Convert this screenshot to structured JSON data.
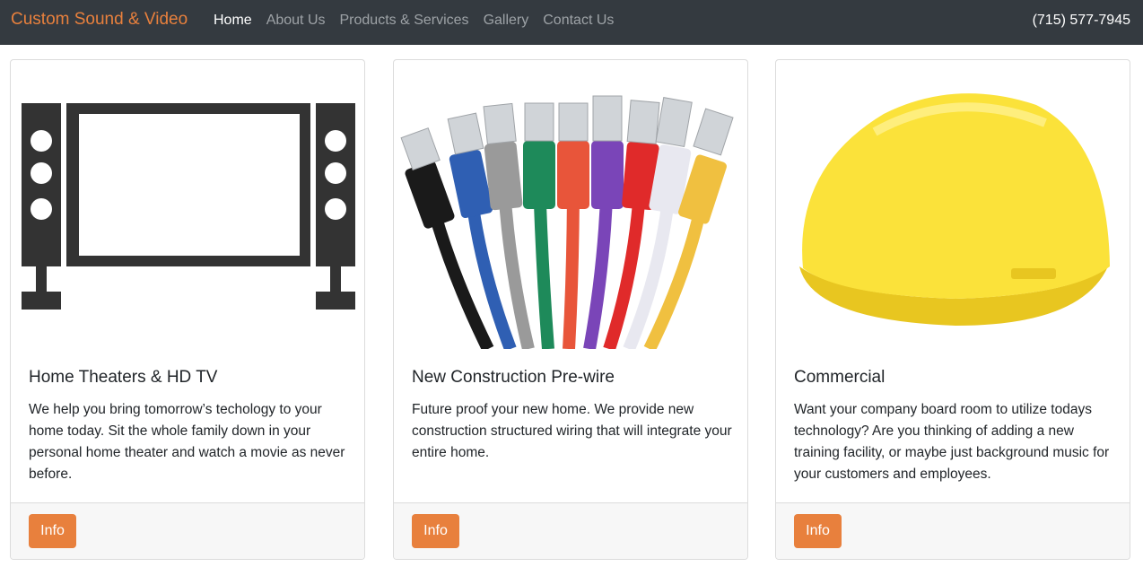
{
  "header": {
    "brand": "Custom Sound & Video",
    "nav": [
      "Home",
      "About Us",
      "Products & Services",
      "Gallery",
      "Contact Us"
    ],
    "active_nav": "Home",
    "phone": "(715) 577-7945"
  },
  "cards": [
    {
      "title": "Home Theaters & HD TV",
      "text": "We help you bring tomorrow’s techology to your home today. Sit the whole family down in your personal home theater and watch a movie as never before.",
      "button": "Info",
      "image_icon": "home-theater-icon"
    },
    {
      "title": "New Construction Pre-wire",
      "text": "Future proof your new home. We provide new construction structured wiring that will integrate your entire home.",
      "button": "Info",
      "image_icon": "network-cables-icon"
    },
    {
      "title": "Commercial",
      "text": "Want your company board room to utilize todays technology? Are you thinking of adding a new training facility, or maybe just background music for your customers and employees.",
      "button": "Info",
      "image_icon": "hard-hat-icon"
    }
  ],
  "colors": {
    "navbar": "#343a40",
    "accent": "#e8803d",
    "nav_inactive": "#9da2a6",
    "hard_hat": "#fbe23a"
  }
}
